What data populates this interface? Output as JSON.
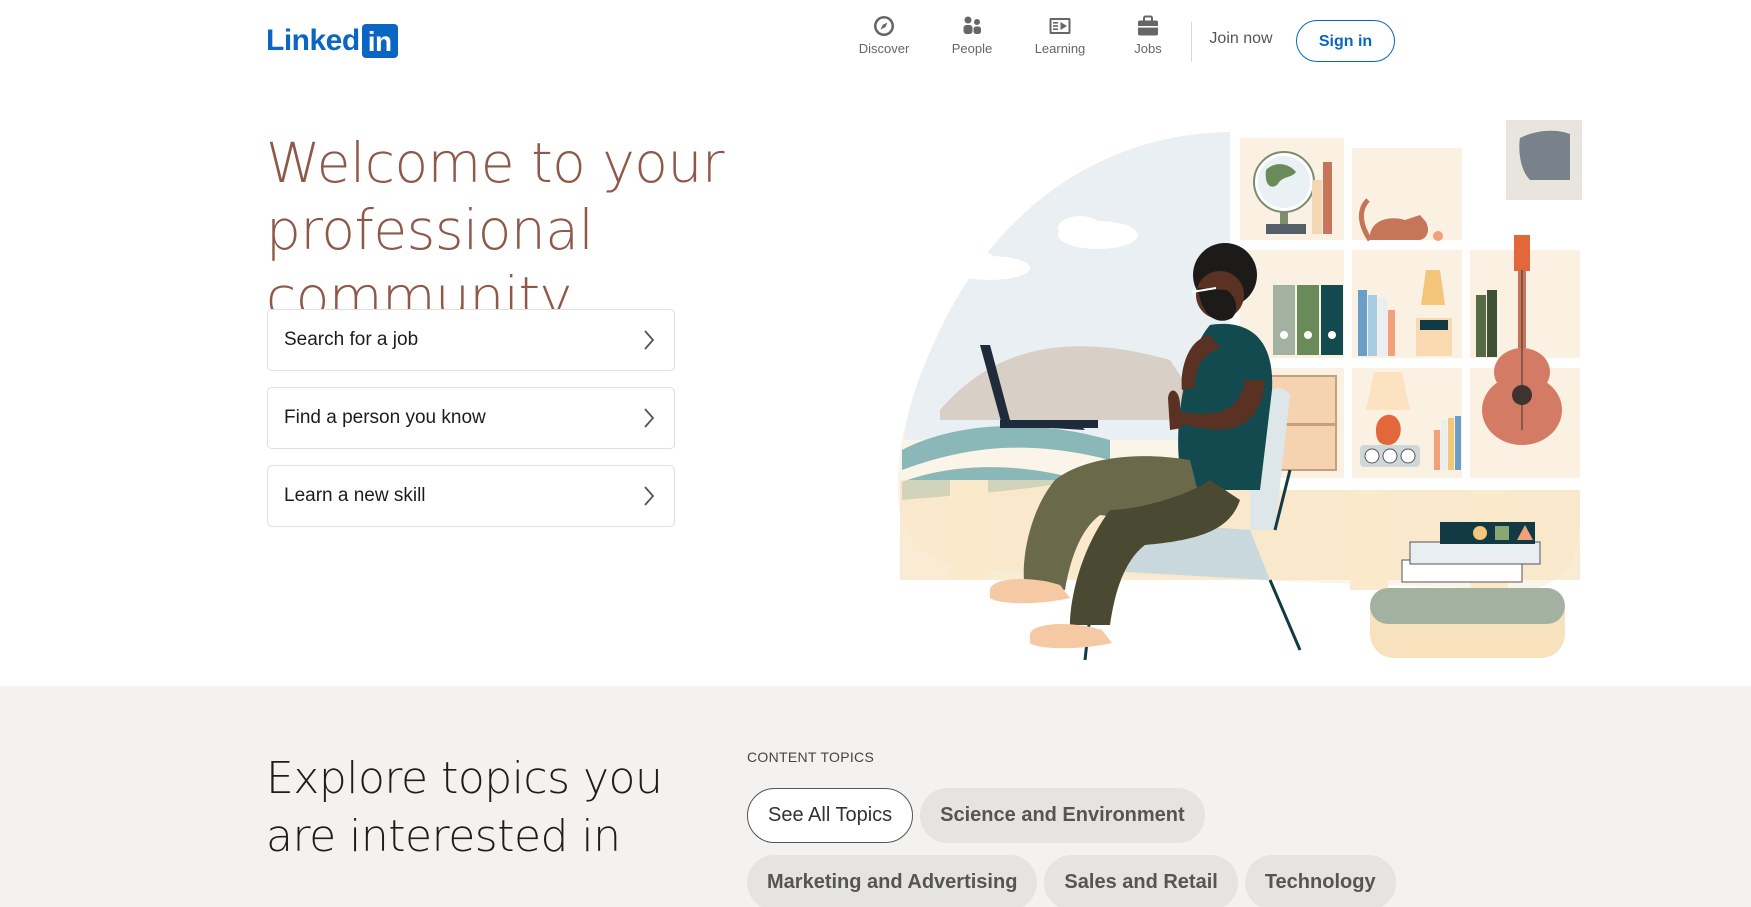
{
  "brand": {
    "logo_text": "Linked",
    "logo_box_text": "in",
    "brand_color": "#0a66c2"
  },
  "nav": {
    "items": [
      {
        "label": "Discover",
        "icon": "compass-icon"
      },
      {
        "label": "People",
        "icon": "people-icon"
      },
      {
        "label": "Learning",
        "icon": "learning-icon"
      },
      {
        "label": "Jobs",
        "icon": "briefcase-icon"
      }
    ],
    "join_label": "Join now",
    "signin_label": "Sign in"
  },
  "hero": {
    "title_line1": "Welcome to your",
    "title_line2": "professional community",
    "title_color": "#8f5849",
    "actions": [
      {
        "label": "Search for a job"
      },
      {
        "label": "Find a person you know"
      },
      {
        "label": "Learn a new skill"
      }
    ]
  },
  "topics": {
    "title_line1": "Explore topics you",
    "title_line2": "are interested in",
    "section_label": "CONTENT TOPICS",
    "pills_row1": [
      "See All Topics",
      "Science and Environment"
    ],
    "pills_row2": [
      "Marketing and Advertising",
      "Sales and Retail",
      "Technology"
    ],
    "background": "#f3f2f0"
  }
}
